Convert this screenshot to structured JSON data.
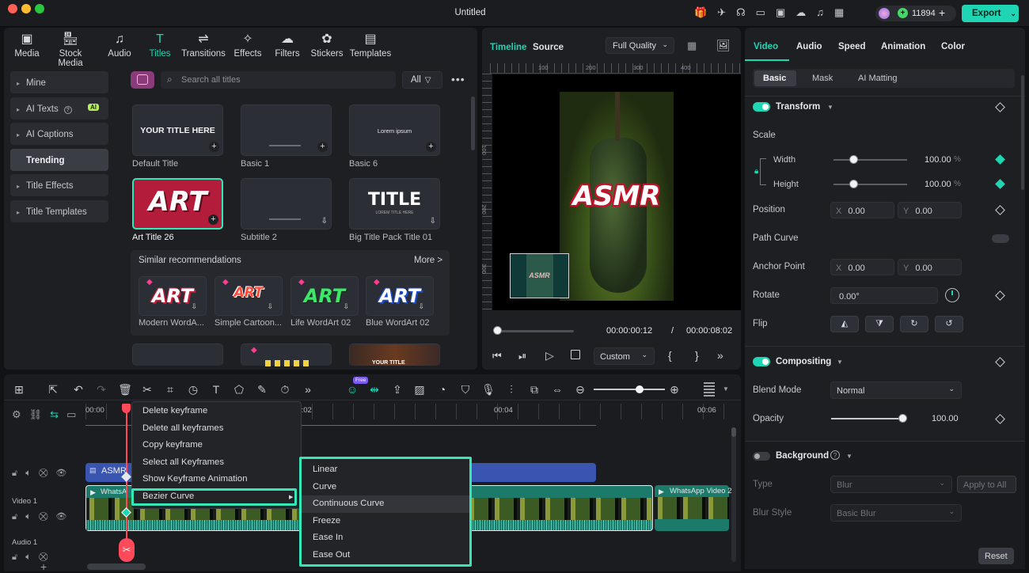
{
  "window": {
    "title": "Untitled",
    "credits": "11894",
    "export_label": "Export"
  },
  "media_tabs": [
    {
      "label": "Media",
      "icon": "media-icon"
    },
    {
      "label": "Stock Media",
      "icon": "stock-media-icon"
    },
    {
      "label": "Audio",
      "icon": "audio-icon"
    },
    {
      "label": "Titles",
      "icon": "titles-icon"
    },
    {
      "label": "Transitions",
      "icon": "transitions-icon"
    },
    {
      "label": "Effects",
      "icon": "effects-icon"
    },
    {
      "label": "Filters",
      "icon": "filters-icon"
    },
    {
      "label": "Stickers",
      "icon": "stickers-icon"
    },
    {
      "label": "Templates",
      "icon": "templates-icon"
    }
  ],
  "sidebar": {
    "items": [
      "Mine",
      "AI Texts",
      "AI Captions",
      "Trending",
      "Title Effects",
      "Title Templates"
    ],
    "ai_badge": "AI"
  },
  "search": {
    "placeholder": "Search all titles",
    "filter_label": "All"
  },
  "titles": [
    {
      "label": "Default Title",
      "thumb": "YOUR TITLE HERE"
    },
    {
      "label": "Basic 1",
      "thumb": ""
    },
    {
      "label": "Basic 6",
      "thumb": "Lorem ipsum"
    },
    {
      "label": "Art Title 26",
      "thumb": "ART"
    },
    {
      "label": "Subtitle 2",
      "thumb": ""
    },
    {
      "label": "Big Title Pack Title 01",
      "thumb": "TITLE",
      "sub": "LOREM TITLE HERE"
    }
  ],
  "recommendations": {
    "heading": "Similar recommendations",
    "more": "More >",
    "items": [
      {
        "label": "Modern WordA...",
        "thumb": "ART"
      },
      {
        "label": "Simple Cartoon...",
        "thumb": "ART"
      },
      {
        "label": "Life WordArt 02",
        "thumb": "ART"
      },
      {
        "label": "Blue WordArt 02",
        "thumb": "ART"
      }
    ]
  },
  "preview": {
    "tab_timeline": "Timeline",
    "tab_source": "Source",
    "quality": "Full Quality",
    "overlay_text": "ASMR",
    "ruler": [
      "100",
      "200",
      "300",
      "400"
    ],
    "vruler": [
      "100",
      "200",
      "300"
    ],
    "current_time": "00:00:00:12",
    "separator": "/",
    "total_time": "00:00:08:02",
    "zoom": "Custom",
    "playhead_fraction": 0.02
  },
  "right_panel": {
    "tabs": [
      "Video",
      "Audio",
      "Speed",
      "Animation",
      "Color"
    ],
    "subtabs": [
      "Basic",
      "Mask",
      "AI Matting"
    ],
    "transform": "Transform",
    "scale": "Scale",
    "width": {
      "label": "Width",
      "value": "100.00",
      "unit": "%"
    },
    "height": {
      "label": "Height",
      "value": "100.00",
      "unit": "%"
    },
    "position": {
      "label": "Position",
      "x_label": "X",
      "x": "0.00",
      "y_label": "Y",
      "y": "0.00"
    },
    "path_curve": "Path Curve",
    "anchor": {
      "label": "Anchor Point",
      "x_label": "X",
      "x": "0.00",
      "y_label": "Y",
      "y": "0.00"
    },
    "rotate": {
      "label": "Rotate",
      "value": "0.00°"
    },
    "flip": "Flip",
    "compositing": "Compositing",
    "blend": {
      "label": "Blend Mode",
      "value": "Normal"
    },
    "opacity": {
      "label": "Opacity",
      "value": "100.00"
    },
    "background": "Background",
    "type": {
      "label": "Type",
      "value": "Blur"
    },
    "apply_all": "Apply to All",
    "blur_style": {
      "label": "Blur Style",
      "value": "Basic Blur"
    },
    "reset": "Reset"
  },
  "timeline": {
    "ruler": [
      "00:00",
      "00:02",
      "00:04",
      "00:06"
    ],
    "tracks": [
      "Video 1",
      "Audio 1"
    ],
    "title_clip": "ASMR",
    "video_clip": "WhatsA",
    "video_clip2": "WhatsApp Video 2",
    "new_badge": "Free"
  },
  "context_menu": {
    "items": [
      "Delete keyframe",
      "Delete all keyframes",
      "Copy keyframe",
      "Select all Keyframes",
      "Show Keyframe Animation",
      "Bezier Curve"
    ],
    "submenu": [
      "Linear",
      "Curve",
      "Continuous Curve",
      "Freeze",
      "Ease In",
      "Ease Out"
    ]
  },
  "colors": {
    "accent": "#1ed6b3",
    "highlight_border": "#35e6b8",
    "title_clip": "#3a55b0",
    "video_clip": "#1b7a6a"
  }
}
